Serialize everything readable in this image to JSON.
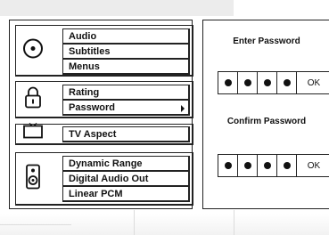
{
  "menu": {
    "groups": [
      {
        "icon": "disc-icon",
        "items": [
          "Audio",
          "Subtitles",
          "Menus"
        ]
      },
      {
        "icon": "lock-icon",
        "items": [
          "Rating",
          "Password"
        ]
      },
      {
        "icon": "tv-icon",
        "items": [
          "TV Aspect"
        ]
      },
      {
        "icon": "speaker-icon",
        "items": [
          "Dynamic Range",
          "Digital Audio Out",
          "Linear PCM"
        ]
      }
    ]
  },
  "password": {
    "enter_label": "Enter Password",
    "confirm_label": "Confirm Password",
    "ok_label": "OK",
    "enter_masked_digits": 4,
    "confirm_masked_digits": 4
  }
}
